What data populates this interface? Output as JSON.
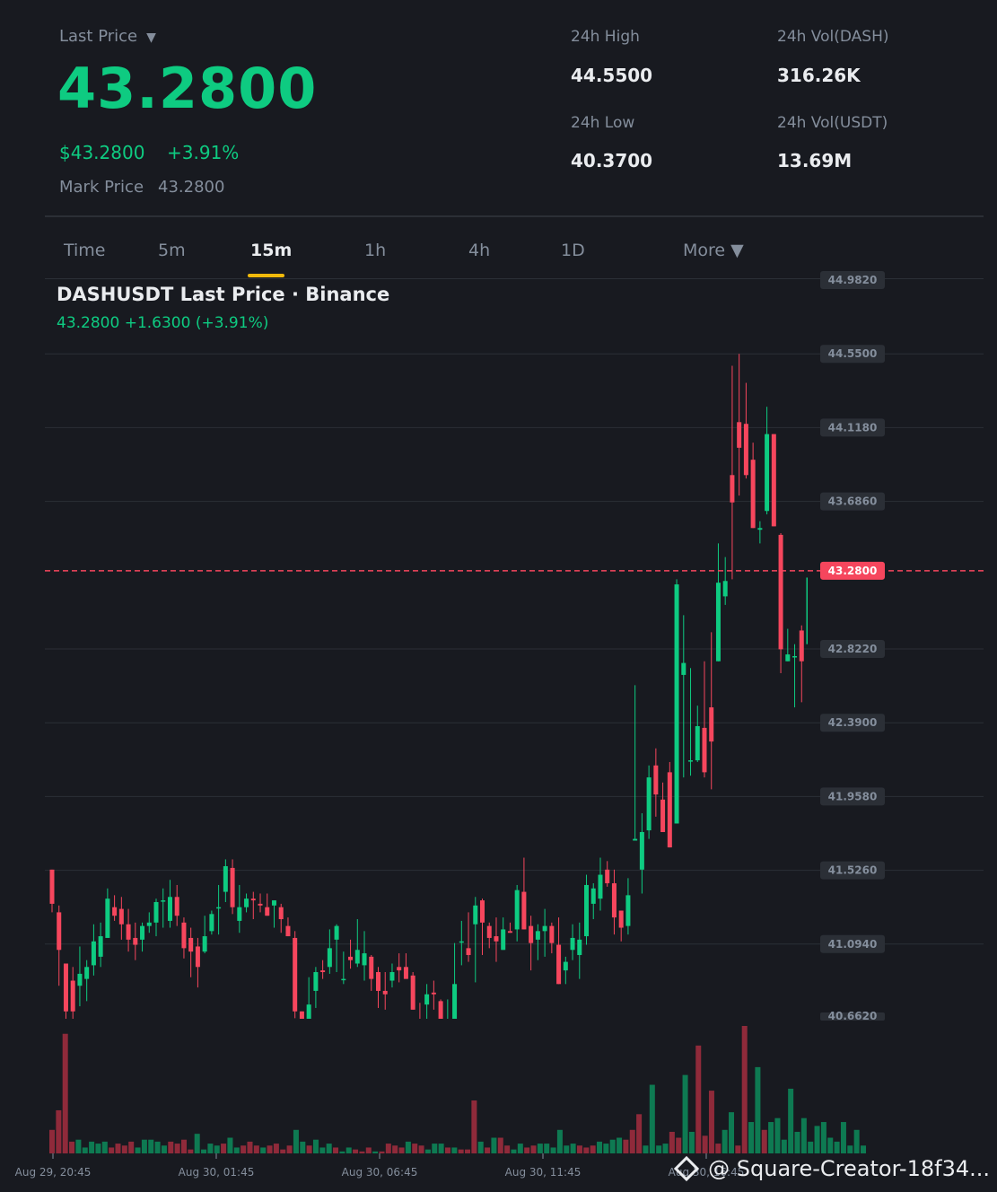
{
  "header": {
    "last_price_label": "Last Price",
    "caret": "▼",
    "last_price": "43.2800",
    "usd_price": "$43.2800",
    "change_pct": "+3.91%",
    "mark_label": "Mark Price",
    "mark_value": "43.2800"
  },
  "stats": {
    "high_label": "24h High",
    "high_value": "44.5500",
    "low_label": "24h Low",
    "low_value": "40.3700",
    "vol_base_label": "24h Vol(DASH)",
    "vol_base_value": "316.26K",
    "vol_quote_label": "24h Vol(USDT)",
    "vol_quote_value": "13.69M"
  },
  "tabs": [
    {
      "label": "Time"
    },
    {
      "label": "5m"
    },
    {
      "label": "15m",
      "active": true
    },
    {
      "label": "1h"
    },
    {
      "label": "4h"
    },
    {
      "label": "1D"
    },
    {
      "label": "More ▼"
    }
  ],
  "chart_title": "DASHUSDT Last Price · Binance",
  "chart_subtitle": "43.2800  +1.6300 (+3.91%)",
  "watermark": "@ Square-Creator-18f34...",
  "colors": {
    "up": "#0ecb81",
    "down": "#f6465d",
    "bg": "#181a20",
    "grid": "#2b2f36",
    "accent": "#f0b90b"
  },
  "chart_data": {
    "type": "candlestick",
    "symbol": "DASHUSDT",
    "interval": "15m",
    "y_ticks": [
      "44.9820",
      "44.5500",
      "44.1180",
      "43.6860",
      "43.2800",
      "42.8220",
      "42.3900",
      "41.9580",
      "41.5260",
      "41.0940",
      "40.6620"
    ],
    "ylim": [
      40.64,
      44.982
    ],
    "current_price": 43.28,
    "x_ticks": [
      "Aug 29, 20:45",
      "Aug 30, 01:45",
      "Aug 30, 06:45",
      "Aug 30, 11:45",
      "Aug 30, 16:45"
    ],
    "candles": [
      [
        41.53,
        41.33,
        41.53,
        41.28
      ],
      [
        41.28,
        41.06,
        41.32,
        40.85
      ],
      [
        40.98,
        40.7,
        40.98,
        40.62
      ],
      [
        40.88,
        40.7,
        40.96,
        40.62
      ],
      [
        40.85,
        40.92,
        41.08,
        40.73
      ],
      [
        40.89,
        40.96,
        41.0,
        40.76
      ],
      [
        40.97,
        41.11,
        41.21,
        40.91
      ],
      [
        41.02,
        41.14,
        41.22,
        40.96
      ],
      [
        41.13,
        41.36,
        41.42,
        41.13
      ],
      [
        41.31,
        41.26,
        41.38,
        41.23
      ],
      [
        41.3,
        41.21,
        41.37,
        41.12
      ],
      [
        41.21,
        41.12,
        41.3,
        41.05
      ],
      [
        41.13,
        41.09,
        41.22,
        41.0
      ],
      [
        41.12,
        41.2,
        41.22,
        41.05
      ],
      [
        41.2,
        41.22,
        41.28,
        41.16
      ],
      [
        41.22,
        41.34,
        41.36,
        41.14
      ],
      [
        41.35,
        41.35,
        41.42,
        41.19
      ],
      [
        41.23,
        41.37,
        41.47,
        41.19
      ],
      [
        41.37,
        41.26,
        41.44,
        41.2
      ],
      [
        41.22,
        41.07,
        41.25,
        41.01
      ],
      [
        41.13,
        41.05,
        41.19,
        40.9
      ],
      [
        41.08,
        40.96,
        41.13,
        40.84
      ],
      [
        41.05,
        41.14,
        41.26,
        41.04
      ],
      [
        41.17,
        41.27,
        41.29,
        41.15
      ],
      [
        41.31,
        41.31,
        41.44,
        41.15
      ],
      [
        41.4,
        41.55,
        41.59,
        41.34
      ],
      [
        41.54,
        41.31,
        41.59,
        41.27
      ],
      [
        41.23,
        41.31,
        41.44,
        41.16
      ],
      [
        41.31,
        41.36,
        41.39,
        41.28
      ],
      [
        41.36,
        41.35,
        41.4,
        41.24
      ],
      [
        41.33,
        41.32,
        41.39,
        41.28
      ],
      [
        41.31,
        41.26,
        41.39,
        41.26
      ],
      [
        41.32,
        41.35,
        41.35,
        41.19
      ],
      [
        41.31,
        41.24,
        41.33,
        41.16
      ],
      [
        41.2,
        41.14,
        41.25,
        41.14
      ],
      [
        41.13,
        40.7,
        41.17,
        40.66
      ],
      [
        40.7,
        40.64,
        40.7,
        40.58
      ],
      [
        40.64,
        40.74,
        40.9,
        40.64
      ],
      [
        40.82,
        40.93,
        40.96,
        40.72
      ],
      [
        40.94,
        40.93,
        41.0,
        40.89
      ],
      [
        40.96,
        41.07,
        41.18,
        40.92
      ],
      [
        41.12,
        41.2,
        41.21,
        40.93
      ],
      [
        40.89,
        40.89,
        41.05,
        40.86
      ],
      [
        41.02,
        41.0,
        41.12,
        40.95
      ],
      [
        40.98,
        41.06,
        41.24,
        40.96
      ],
      [
        40.97,
        41.04,
        41.17,
        40.88
      ],
      [
        41.02,
        40.89,
        41.03,
        40.82
      ],
      [
        40.93,
        40.82,
        40.96,
        40.72
      ],
      [
        40.82,
        40.8,
        40.93,
        40.71
      ],
      [
        40.88,
        40.93,
        40.98,
        40.84
      ],
      [
        40.96,
        40.94,
        41.04,
        40.87
      ],
      [
        40.96,
        40.89,
        41.04,
        40.89
      ],
      [
        40.91,
        40.71,
        40.93,
        40.73
      ],
      [
        40.65,
        40.62,
        40.75,
        40.59
      ],
      [
        40.74,
        40.8,
        40.86,
        40.63
      ],
      [
        40.81,
        40.8,
        40.88,
        40.71
      ],
      [
        40.76,
        40.59,
        40.77,
        40.58
      ],
      [
        40.58,
        40.64,
        40.77,
        40.64
      ],
      [
        40.63,
        40.86,
        41.1,
        40.6
      ],
      [
        41.11,
        41.11,
        41.23,
        40.97
      ],
      [
        41.07,
        41.03,
        41.28,
        40.99
      ],
      [
        41.21,
        41.32,
        41.37,
        40.87
      ],
      [
        41.35,
        41.22,
        41.36,
        41.03
      ],
      [
        41.2,
        41.13,
        41.22,
        41.07
      ],
      [
        41.14,
        41.11,
        41.25,
        40.99
      ],
      [
        41.06,
        41.18,
        41.25,
        41.15
      ],
      [
        41.17,
        41.16,
        41.22,
        41.16
      ],
      [
        41.18,
        41.41,
        41.44,
        41.11
      ],
      [
        41.4,
        41.18,
        41.6,
        41.28
      ],
      [
        41.2,
        41.1,
        41.26,
        40.94
      ],
      [
        41.12,
        41.17,
        41.21,
        41.0
      ],
      [
        41.17,
        41.2,
        41.3,
        41.02
      ],
      [
        41.2,
        41.1,
        41.22,
        41.04
      ],
      [
        41.09,
        40.86,
        41.25,
        40.86
      ],
      [
        40.94,
        40.99,
        41.02,
        40.86
      ],
      [
        41.06,
        41.13,
        41.21,
        41.0
      ],
      [
        41.03,
        41.12,
        41.22,
        40.89
      ],
      [
        41.14,
        41.44,
        41.5,
        41.09
      ],
      [
        41.33,
        41.42,
        41.45,
        41.24
      ],
      [
        41.36,
        41.5,
        41.6,
        41.29
      ],
      [
        41.53,
        41.45,
        41.58,
        41.43
      ],
      [
        41.45,
        41.25,
        41.53,
        41.15
      ],
      [
        41.29,
        41.19,
        41.29,
        41.11
      ],
      [
        41.2,
        41.38,
        41.48,
        41.15
      ],
      [
        41.7,
        41.71,
        42.61,
        41.75
      ],
      [
        41.53,
        41.75,
        41.86,
        41.39
      ],
      [
        41.76,
        42.07,
        42.14,
        41.71
      ],
      [
        42.14,
        41.97,
        42.24,
        41.84
      ],
      [
        41.94,
        41.75,
        42.04,
        41.84
      ],
      [
        42.1,
        41.66,
        42.16,
        41.72
      ],
      [
        41.8,
        43.2,
        43.23,
        42.45
      ],
      [
        42.67,
        42.74,
        43.02,
        42.07
      ],
      [
        42.17,
        42.17,
        42.71,
        42.08
      ],
      [
        42.17,
        42.37,
        42.49,
        42.16
      ],
      [
        42.36,
        42.1,
        42.75,
        42.07
      ],
      [
        42.48,
        42.28,
        42.92,
        42.0
      ],
      [
        42.75,
        43.21,
        43.44,
        42.84
      ],
      [
        43.13,
        43.22,
        43.36,
        43.08
      ],
      [
        43.84,
        43.68,
        44.48,
        43.23
      ],
      [
        44.15,
        44.0,
        44.55,
        43.72
      ],
      [
        44.14,
        43.84,
        44.38,
        43.82
      ],
      [
        43.93,
        43.53,
        44.03,
        43.68
      ],
      [
        43.52,
        43.53,
        43.57,
        43.44
      ],
      [
        43.63,
        44.08,
        44.24,
        43.61
      ],
      [
        44.08,
        43.54,
        44.08,
        43.59
      ],
      [
        43.49,
        42.82,
        43.5,
        42.68
      ],
      [
        42.75,
        42.79,
        42.94,
        42.78
      ],
      [
        42.78,
        42.78,
        42.85,
        42.48
      ],
      [
        42.93,
        42.75,
        42.96,
        42.51
      ],
      [
        42.85,
        43.24,
        43.3,
        42.84
      ]
    ],
    "volumes": [
      0.12,
      0.22,
      0.61,
      0.06,
      0.07,
      0.03,
      0.06,
      0.05,
      0.06,
      0.03,
      0.05,
      0.04,
      0.06,
      0.03,
      0.07,
      0.07,
      0.06,
      0.04,
      0.06,
      0.05,
      0.07,
      0.02,
      0.1,
      0.02,
      0.05,
      0.04,
      0.05,
      0.08,
      0.03,
      0.04,
      0.06,
      0.04,
      0.03,
      0.04,
      0.05,
      0.02,
      0.04,
      0.12,
      0.06,
      0.04,
      0.07,
      0.03,
      0.05,
      0.03,
      0.01,
      0.03,
      0.02,
      0.01,
      0.03,
      0.01,
      0.01,
      0.05,
      0.04,
      0.03,
      0.06,
      0.05,
      0.04,
      0.02,
      0.05,
      0.05,
      0.03,
      0.03,
      0.02,
      0.02,
      0.27,
      0.06,
      0.03,
      0.08,
      0.08,
      0.04,
      0.02,
      0.05,
      0.03,
      0.04,
      0.05,
      0.05,
      0.03,
      0.12,
      0.04,
      0.05,
      0.04,
      0.03,
      0.04,
      0.06,
      0.05,
      0.07,
      0.08,
      0.07,
      0.12,
      0.2,
      0.04,
      0.35,
      0.04,
      0.05,
      0.11,
      0.08,
      0.4,
      0.11,
      0.55,
      0.09,
      0.32,
      0.05,
      0.12,
      0.21,
      0.04,
      0.65,
      0.16,
      0.44,
      0.12,
      0.16,
      0.18,
      0.07,
      0.33,
      0.11,
      0.18,
      0.06,
      0.14,
      0.16,
      0.08,
      0.06,
      0.16,
      0.04,
      0.12,
      0.04
    ]
  }
}
